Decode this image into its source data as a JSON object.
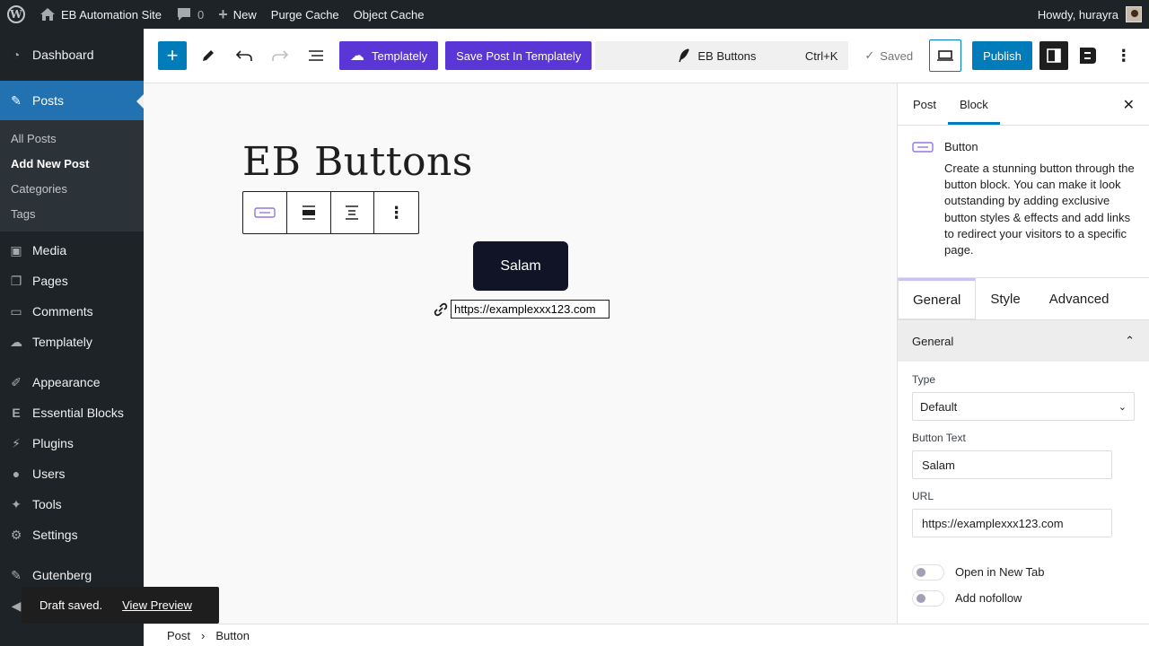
{
  "adminbar": {
    "site_name": "EB Automation Site",
    "comments_count": "0",
    "new_label": "New",
    "purge_cache": "Purge Cache",
    "object_cache": "Object Cache",
    "howdy": "Howdy, hurayra"
  },
  "adminmenu": {
    "dashboard": "Dashboard",
    "posts": "Posts",
    "submenu": [
      "All Posts",
      "Add New Post",
      "Categories",
      "Tags"
    ],
    "media": "Media",
    "pages": "Pages",
    "comments": "Comments",
    "templately": "Templately",
    "appearance": "Appearance",
    "essential_blocks": "Essential Blocks",
    "plugins": "Plugins",
    "users": "Users",
    "tools": "Tools",
    "settings": "Settings",
    "gutenberg": "Gutenberg"
  },
  "toolbar": {
    "templately": "Templately",
    "save_templately": "Save Post In Templately",
    "doc_title": "EB Buttons",
    "shortcut": "Ctrl+K",
    "saved": "Saved",
    "publish": "Publish"
  },
  "canvas": {
    "post_title": "EB Buttons",
    "button_text": "Salam",
    "url": "https://examplexxx123.com"
  },
  "sidebar": {
    "tab_post": "Post",
    "tab_block": "Block",
    "block_name": "Button",
    "block_desc": "Create a stunning button through the button block. You can make it look outstanding by adding exclusive button styles & effects and add links to redirect your visitors to a specific page.",
    "eb_tabs": [
      "General",
      "Style",
      "Advanced"
    ],
    "panel_title": "General",
    "type_label": "Type",
    "type_value": "Default",
    "button_text_label": "Button Text",
    "button_text_value": "Salam",
    "url_label": "URL",
    "url_value": "https://examplexxx123.com",
    "open_new_tab": "Open in New Tab",
    "add_nofollow": "Add nofollow"
  },
  "footer": {
    "crumb_post": "Post",
    "crumb_button": "Button"
  },
  "snackbar": {
    "message": "Draft saved.",
    "link": "View Preview"
  },
  "colors": {
    "admin_dark": "#1d2327",
    "accent_blue": "#007cba",
    "templately_purple": "#5b36d6",
    "button_bg": "#101426"
  }
}
